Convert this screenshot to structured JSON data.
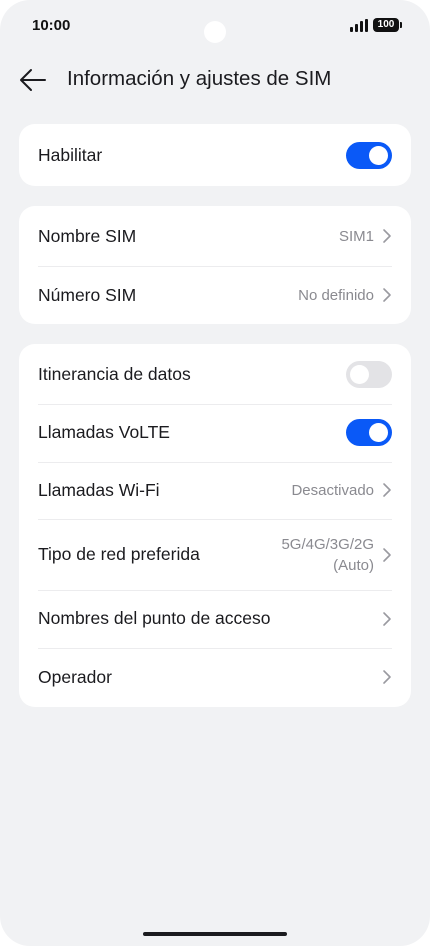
{
  "status_bar": {
    "time": "10:00",
    "battery": "100"
  },
  "header": {
    "title": "Información y ajustes de SIM"
  },
  "colors": {
    "accent": "#0a59f7",
    "background": "#f1f2f4",
    "card": "#ffffff",
    "secondary_text": "#8a8a90"
  },
  "enable_card": {
    "enable": {
      "label": "Habilitar",
      "on": true
    }
  },
  "sim_card": {
    "name": {
      "label": "Nombre SIM",
      "value": "SIM1"
    },
    "number": {
      "label": "Número SIM",
      "value": "No definido"
    }
  },
  "network_card": {
    "roaming": {
      "label": "Itinerancia de datos",
      "on": false
    },
    "volte": {
      "label": "Llamadas VoLTE",
      "on": true
    },
    "wifi_calls": {
      "label": "Llamadas Wi-Fi",
      "value": "Desactivado"
    },
    "network_type": {
      "label": "Tipo de red preferida",
      "value_line1": "5G/4G/3G/2G",
      "value_line2": "(Auto)"
    },
    "apn": {
      "label": "Nombres del punto de acceso"
    },
    "operator": {
      "label": "Operador"
    }
  },
  "icons": {
    "back": "arrow-left-icon",
    "chevron": "chevron-right-icon",
    "signal": "signal-icon",
    "battery": "battery-icon"
  }
}
